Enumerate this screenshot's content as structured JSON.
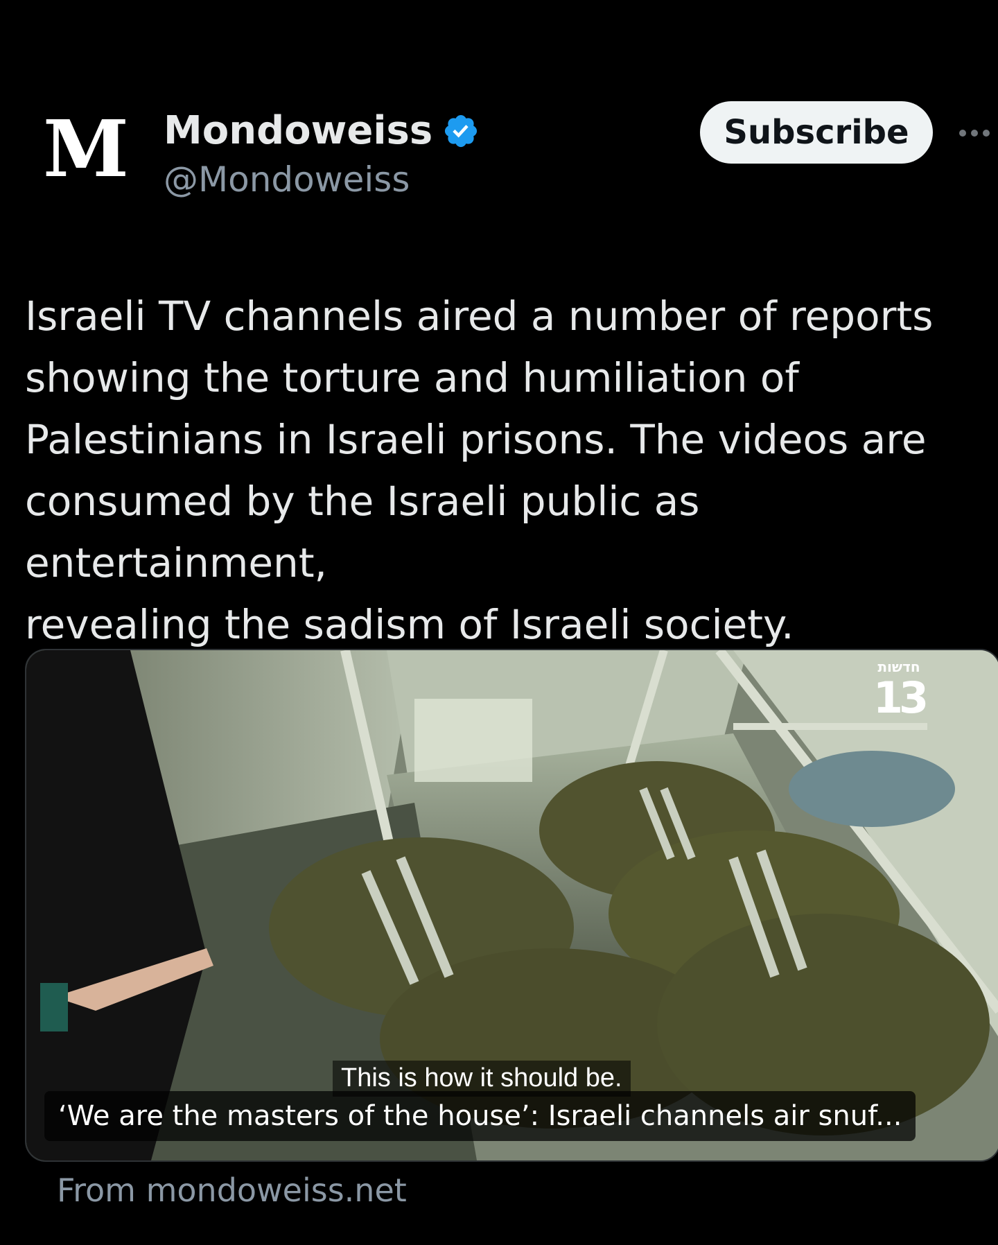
{
  "account": {
    "avatar_letter": "M",
    "display_name": "Mondoweiss",
    "handle": "@Mondoweiss",
    "verified_icon": "verified-badge-icon"
  },
  "actions": {
    "subscribe_label": "Subscribe",
    "more_icon": "more-options-icon"
  },
  "tweet": {
    "text": "Israeli TV channels aired a number of reports\nshowing the torture and humiliation of\nPalestinians in Israeli prisons. The videos are\nconsumed by the Israeli public as entertainment,\nrevealing the sadism of Israeli society."
  },
  "media_card": {
    "channel_logo_label": "חדשות",
    "channel_logo_number": "13",
    "subtitle": "This is how it should be.",
    "title": "‘We are the masters of the house’: Israeli channels air snuf...",
    "source": "From mondoweiss.net"
  },
  "colors": {
    "background": "#000000",
    "text_primary": "#e7e9ea",
    "text_secondary": "#8b98a5",
    "verified_blue": "#1d9bf0",
    "button_bg": "#eff3f4",
    "logo_red": "#e4202c"
  }
}
